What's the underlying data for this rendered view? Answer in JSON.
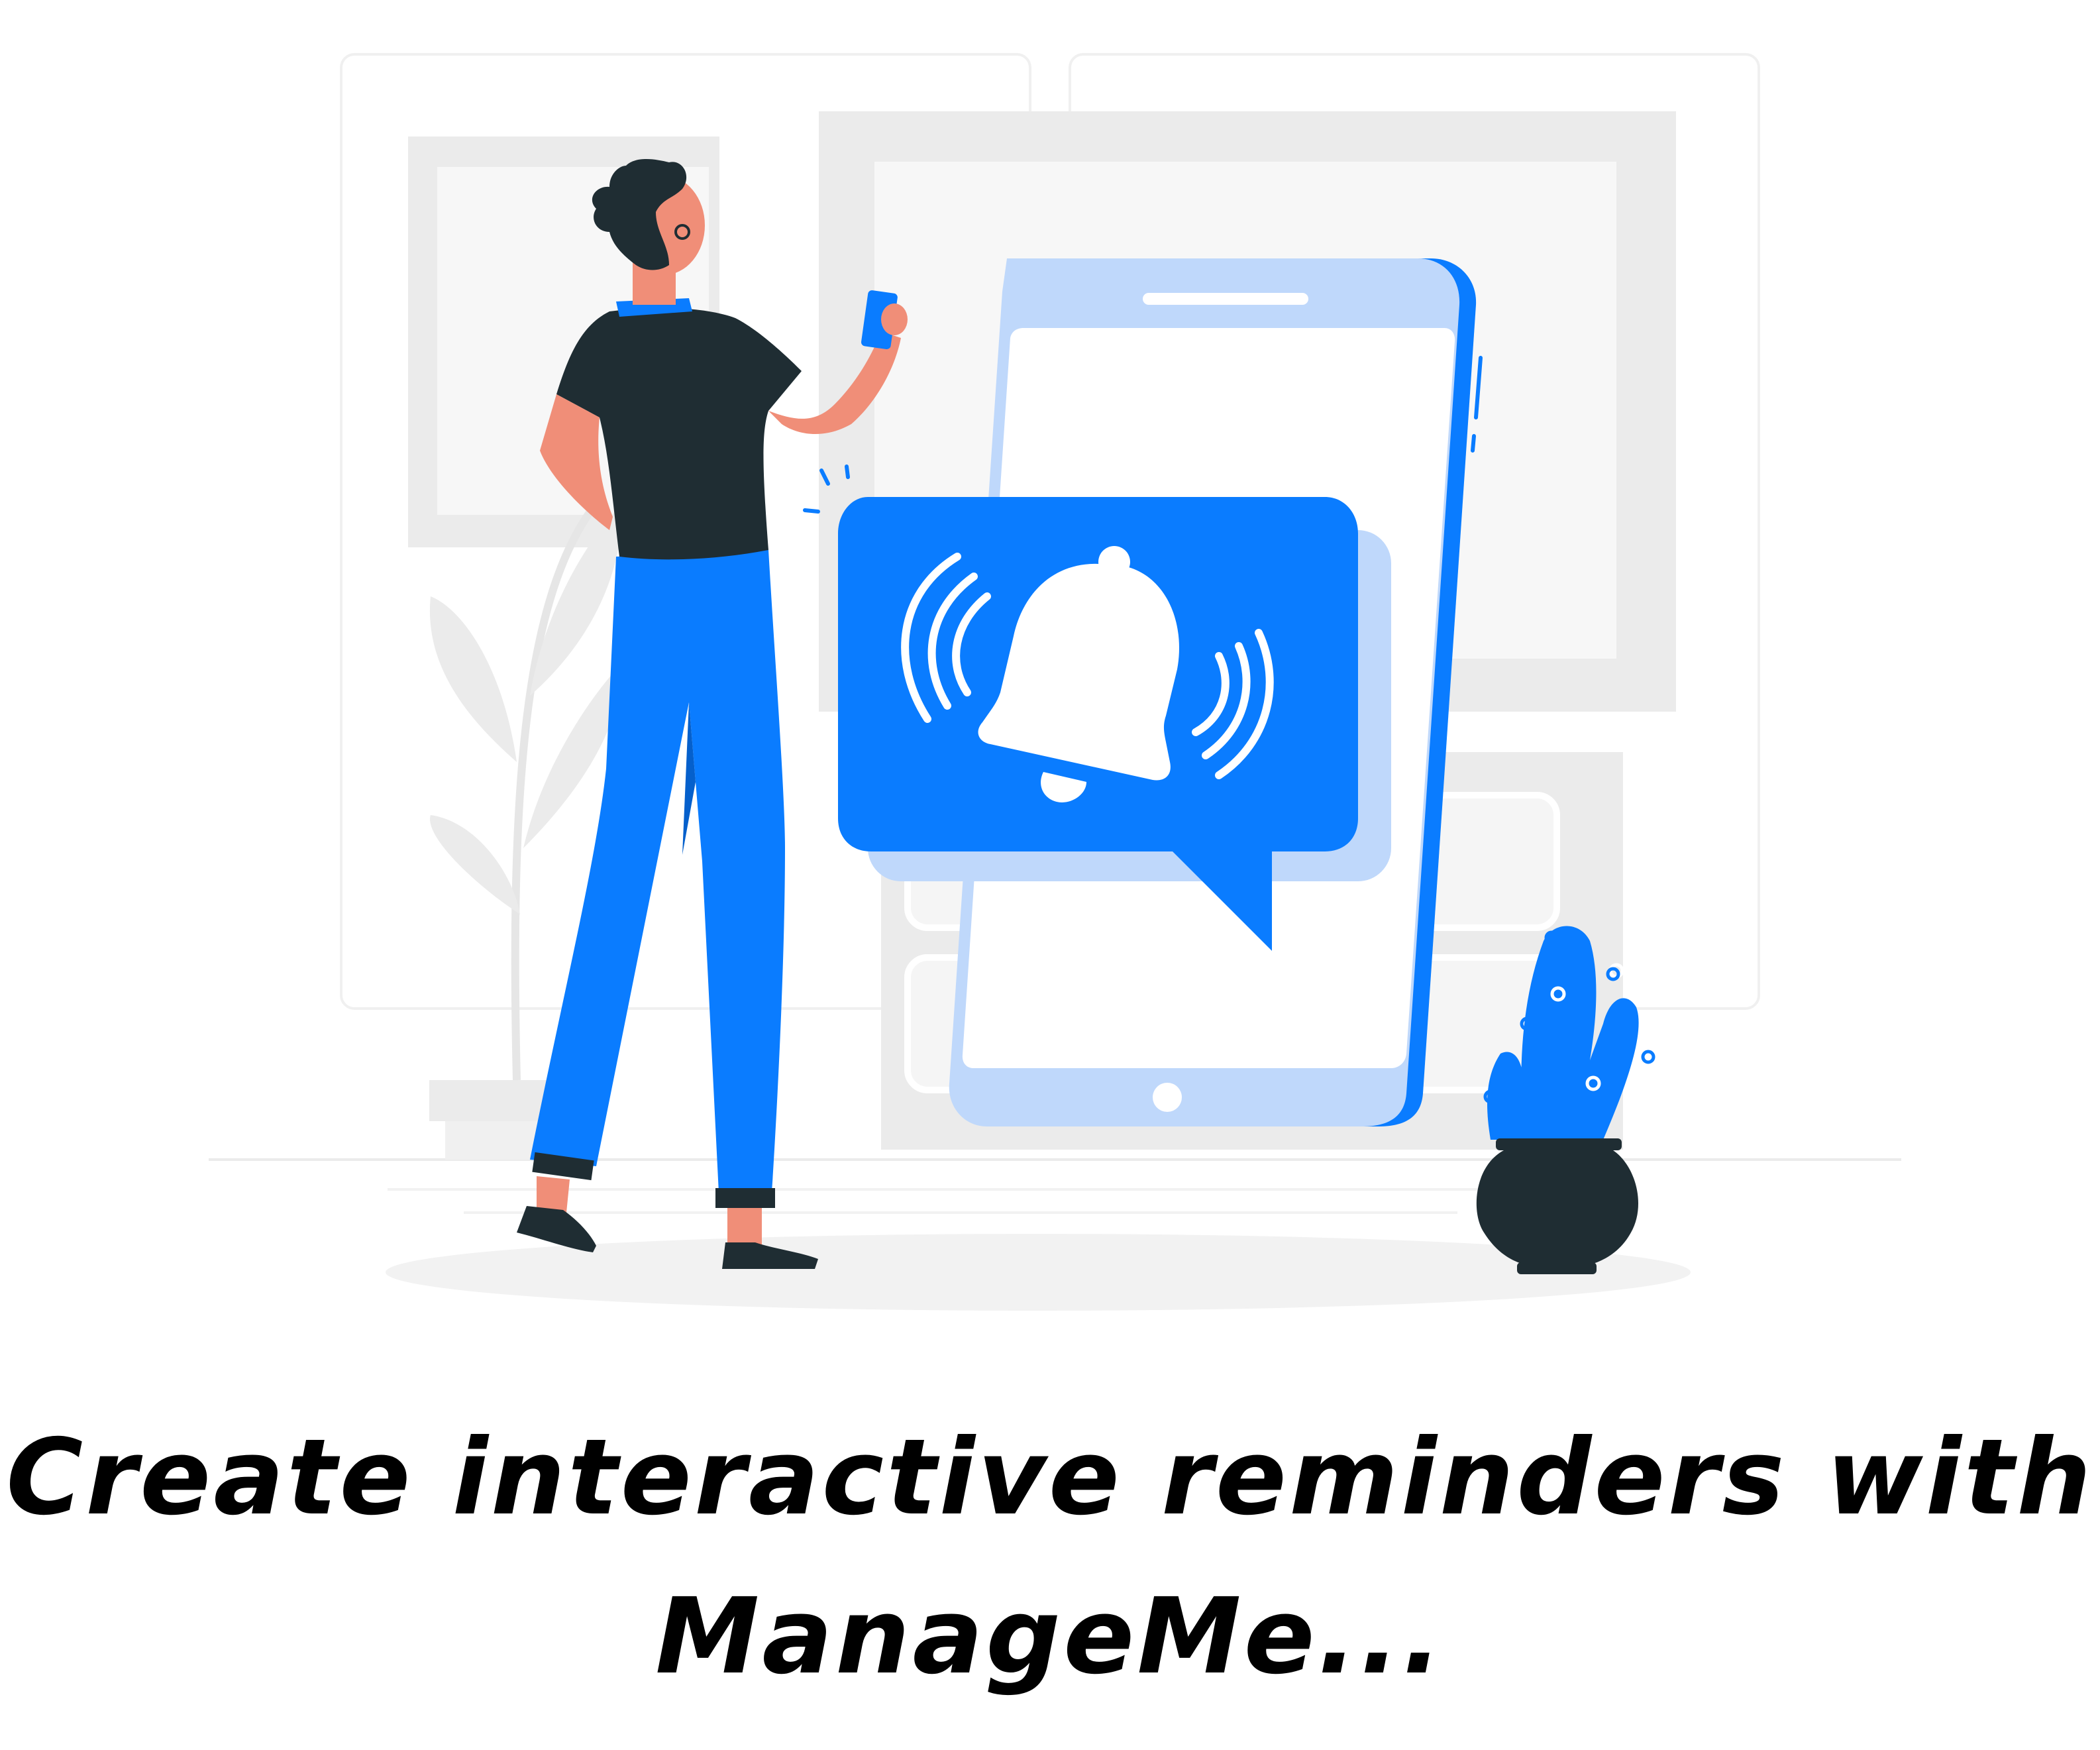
{
  "headline": {
    "line1": "Create interactive reminders with",
    "line2": "ManageMe..."
  },
  "illustration": {
    "icons": [
      "bell-icon",
      "ringing-waves-icon",
      "smartphone-icon",
      "chat-bubble-icon",
      "plant-icon",
      "cactus-icon",
      "person-figure"
    ],
    "colors": {
      "accent": "#0A7CFF",
      "accent_light": "#BFD8FB",
      "dark": "#1F2D33",
      "skin": "#F08E78",
      "background_gray": "#EBEBEB"
    }
  }
}
